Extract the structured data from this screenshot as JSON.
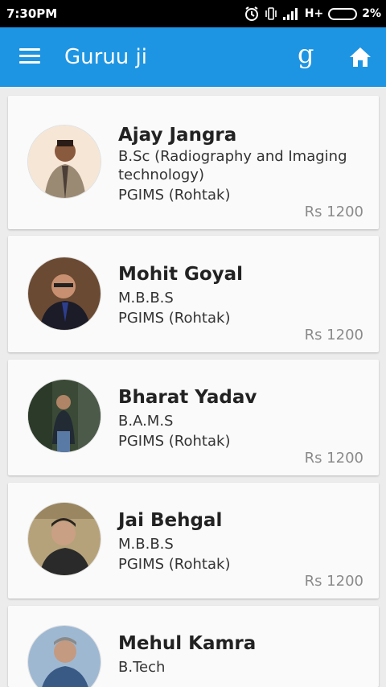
{
  "status_bar": {
    "time": "7:30PM",
    "network": "H+",
    "battery": "2%"
  },
  "app_bar": {
    "title": "Guruu ji",
    "logo_letter": "g",
    "accent_color": "#1e95e2"
  },
  "tutors": [
    {
      "name": "Ajay Jangra",
      "course": "B.Sc (Radiography and Imaging technology)",
      "college": "PGIMS (Rohtak)",
      "price": "Rs 1200"
    },
    {
      "name": "Mohit Goyal",
      "course": "M.B.B.S",
      "college": "PGIMS (Rohtak)",
      "price": "Rs 1200"
    },
    {
      "name": "Bharat Yadav",
      "course": "B.A.M.S",
      "college": "PGIMS (Rohtak)",
      "price": "Rs 1200"
    },
    {
      "name": "Jai Behgal",
      "course": "M.B.B.S",
      "college": "PGIMS (Rohtak)",
      "price": "Rs 1200"
    },
    {
      "name": "Mehul Kamra",
      "course": "B.Tech",
      "college": "",
      "price": ""
    }
  ]
}
